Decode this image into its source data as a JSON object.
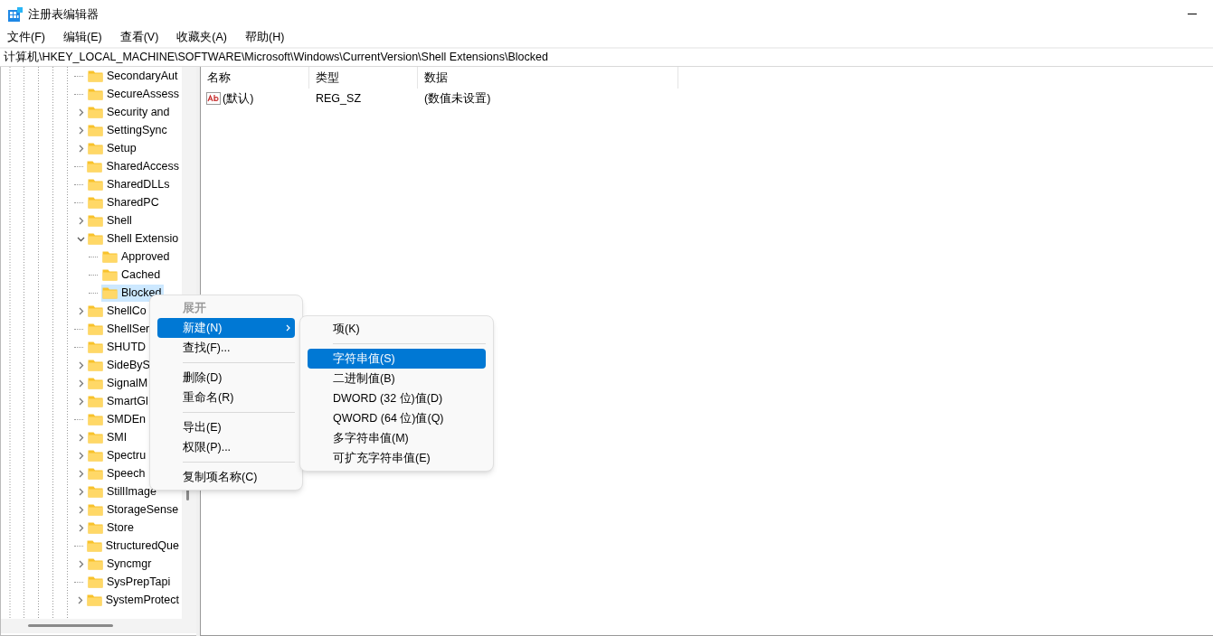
{
  "window": {
    "title": "注册表编辑器"
  },
  "menu_bar": [
    "文件(F)",
    "编辑(E)",
    "查看(V)",
    "收藏夹(A)",
    "帮助(H)"
  ],
  "address": "计算机\\HKEY_LOCAL_MACHINE\\SOFTWARE\\Microsoft\\Windows\\CurrentVersion\\Shell Extensions\\Blocked",
  "tree": [
    {
      "label": "SecondaryAut",
      "has_children": false,
      "selected": false
    },
    {
      "label": "SecureAssess",
      "has_children": false,
      "selected": false
    },
    {
      "label": "Security and",
      "has_children": true,
      "expanded": false,
      "selected": false
    },
    {
      "label": "SettingSync",
      "has_children": true,
      "expanded": false,
      "selected": false
    },
    {
      "label": "Setup",
      "has_children": true,
      "expanded": false,
      "selected": false
    },
    {
      "label": "SharedAccess",
      "has_children": false,
      "selected": false
    },
    {
      "label": "SharedDLLs",
      "has_children": false,
      "selected": false
    },
    {
      "label": "SharedPC",
      "has_children": false,
      "selected": false
    },
    {
      "label": "Shell",
      "has_children": true,
      "expanded": false,
      "selected": false
    },
    {
      "label": "Shell Extensio",
      "has_children": true,
      "expanded": true,
      "selected": false,
      "children": [
        {
          "label": "Approved",
          "has_children": false,
          "selected": false
        },
        {
          "label": "Cached",
          "has_children": false,
          "selected": false
        },
        {
          "label": "Blocked",
          "has_children": false,
          "selected": true
        }
      ]
    },
    {
      "label": "ShellCo",
      "has_children": true,
      "expanded": false,
      "selected": false
    },
    {
      "label": "ShellSer",
      "has_children": false,
      "selected": false
    },
    {
      "label": "SHUTD",
      "has_children": false,
      "selected": false
    },
    {
      "label": "SideByS",
      "has_children": true,
      "expanded": false,
      "selected": false
    },
    {
      "label": "SignalM",
      "has_children": true,
      "expanded": false,
      "selected": false
    },
    {
      "label": "SmartGl",
      "has_children": true,
      "expanded": false,
      "selected": false
    },
    {
      "label": "SMDEn",
      "has_children": false,
      "selected": false
    },
    {
      "label": "SMI",
      "has_children": true,
      "expanded": false,
      "selected": false
    },
    {
      "label": "Spectru",
      "has_children": true,
      "expanded": false,
      "selected": false
    },
    {
      "label": "Speech",
      "has_children": true,
      "expanded": false,
      "selected": false
    },
    {
      "label": "StillImage",
      "has_children": true,
      "expanded": false,
      "selected": false
    },
    {
      "label": "StorageSense",
      "has_children": true,
      "expanded": false,
      "selected": false
    },
    {
      "label": "Store",
      "has_children": true,
      "expanded": false,
      "selected": false
    },
    {
      "label": "StructuredQue",
      "has_children": false,
      "selected": false
    },
    {
      "label": "Syncmgr",
      "has_children": true,
      "expanded": false,
      "selected": false
    },
    {
      "label": "SysPrepTapi",
      "has_children": false,
      "selected": false
    },
    {
      "label": "SystemProtect",
      "has_children": true,
      "expanded": false,
      "selected": false
    }
  ],
  "table": {
    "columns": [
      "名称",
      "类型",
      "数据"
    ],
    "rows": [
      {
        "name": "(默认)",
        "type": "REG_SZ",
        "data": "(数值未设置)"
      }
    ]
  },
  "context_menu": [
    {
      "kind": "item",
      "label": "展开",
      "disabled": true,
      "selected": false,
      "submenu": false
    },
    {
      "kind": "item",
      "label": "新建(N)",
      "disabled": false,
      "selected": true,
      "submenu": true
    },
    {
      "kind": "item",
      "label": "查找(F)...",
      "disabled": false,
      "selected": false,
      "submenu": false
    },
    {
      "kind": "separator"
    },
    {
      "kind": "item",
      "label": "删除(D)",
      "disabled": false,
      "selected": false,
      "submenu": false
    },
    {
      "kind": "item",
      "label": "重命名(R)",
      "disabled": false,
      "selected": false,
      "submenu": false
    },
    {
      "kind": "separator"
    },
    {
      "kind": "item",
      "label": "导出(E)",
      "disabled": false,
      "selected": false,
      "submenu": false
    },
    {
      "kind": "item",
      "label": "权限(P)...",
      "disabled": false,
      "selected": false,
      "submenu": false
    },
    {
      "kind": "separator"
    },
    {
      "kind": "item",
      "label": "复制项名称(C)",
      "disabled": false,
      "selected": false,
      "submenu": false
    }
  ],
  "submenu": [
    {
      "kind": "item",
      "label": "项(K)",
      "selected": false
    },
    {
      "kind": "separator"
    },
    {
      "kind": "item",
      "label": "字符串值(S)",
      "selected": true
    },
    {
      "kind": "item",
      "label": "二进制值(B)",
      "selected": false
    },
    {
      "kind": "item",
      "label": "DWORD (32 位)值(D)",
      "selected": false
    },
    {
      "kind": "item",
      "label": "QWORD (64 位)值(Q)",
      "selected": false
    },
    {
      "kind": "item",
      "label": "多字符串值(M)",
      "selected": false
    },
    {
      "kind": "item",
      "label": "可扩充字符串值(E)",
      "selected": false
    }
  ]
}
